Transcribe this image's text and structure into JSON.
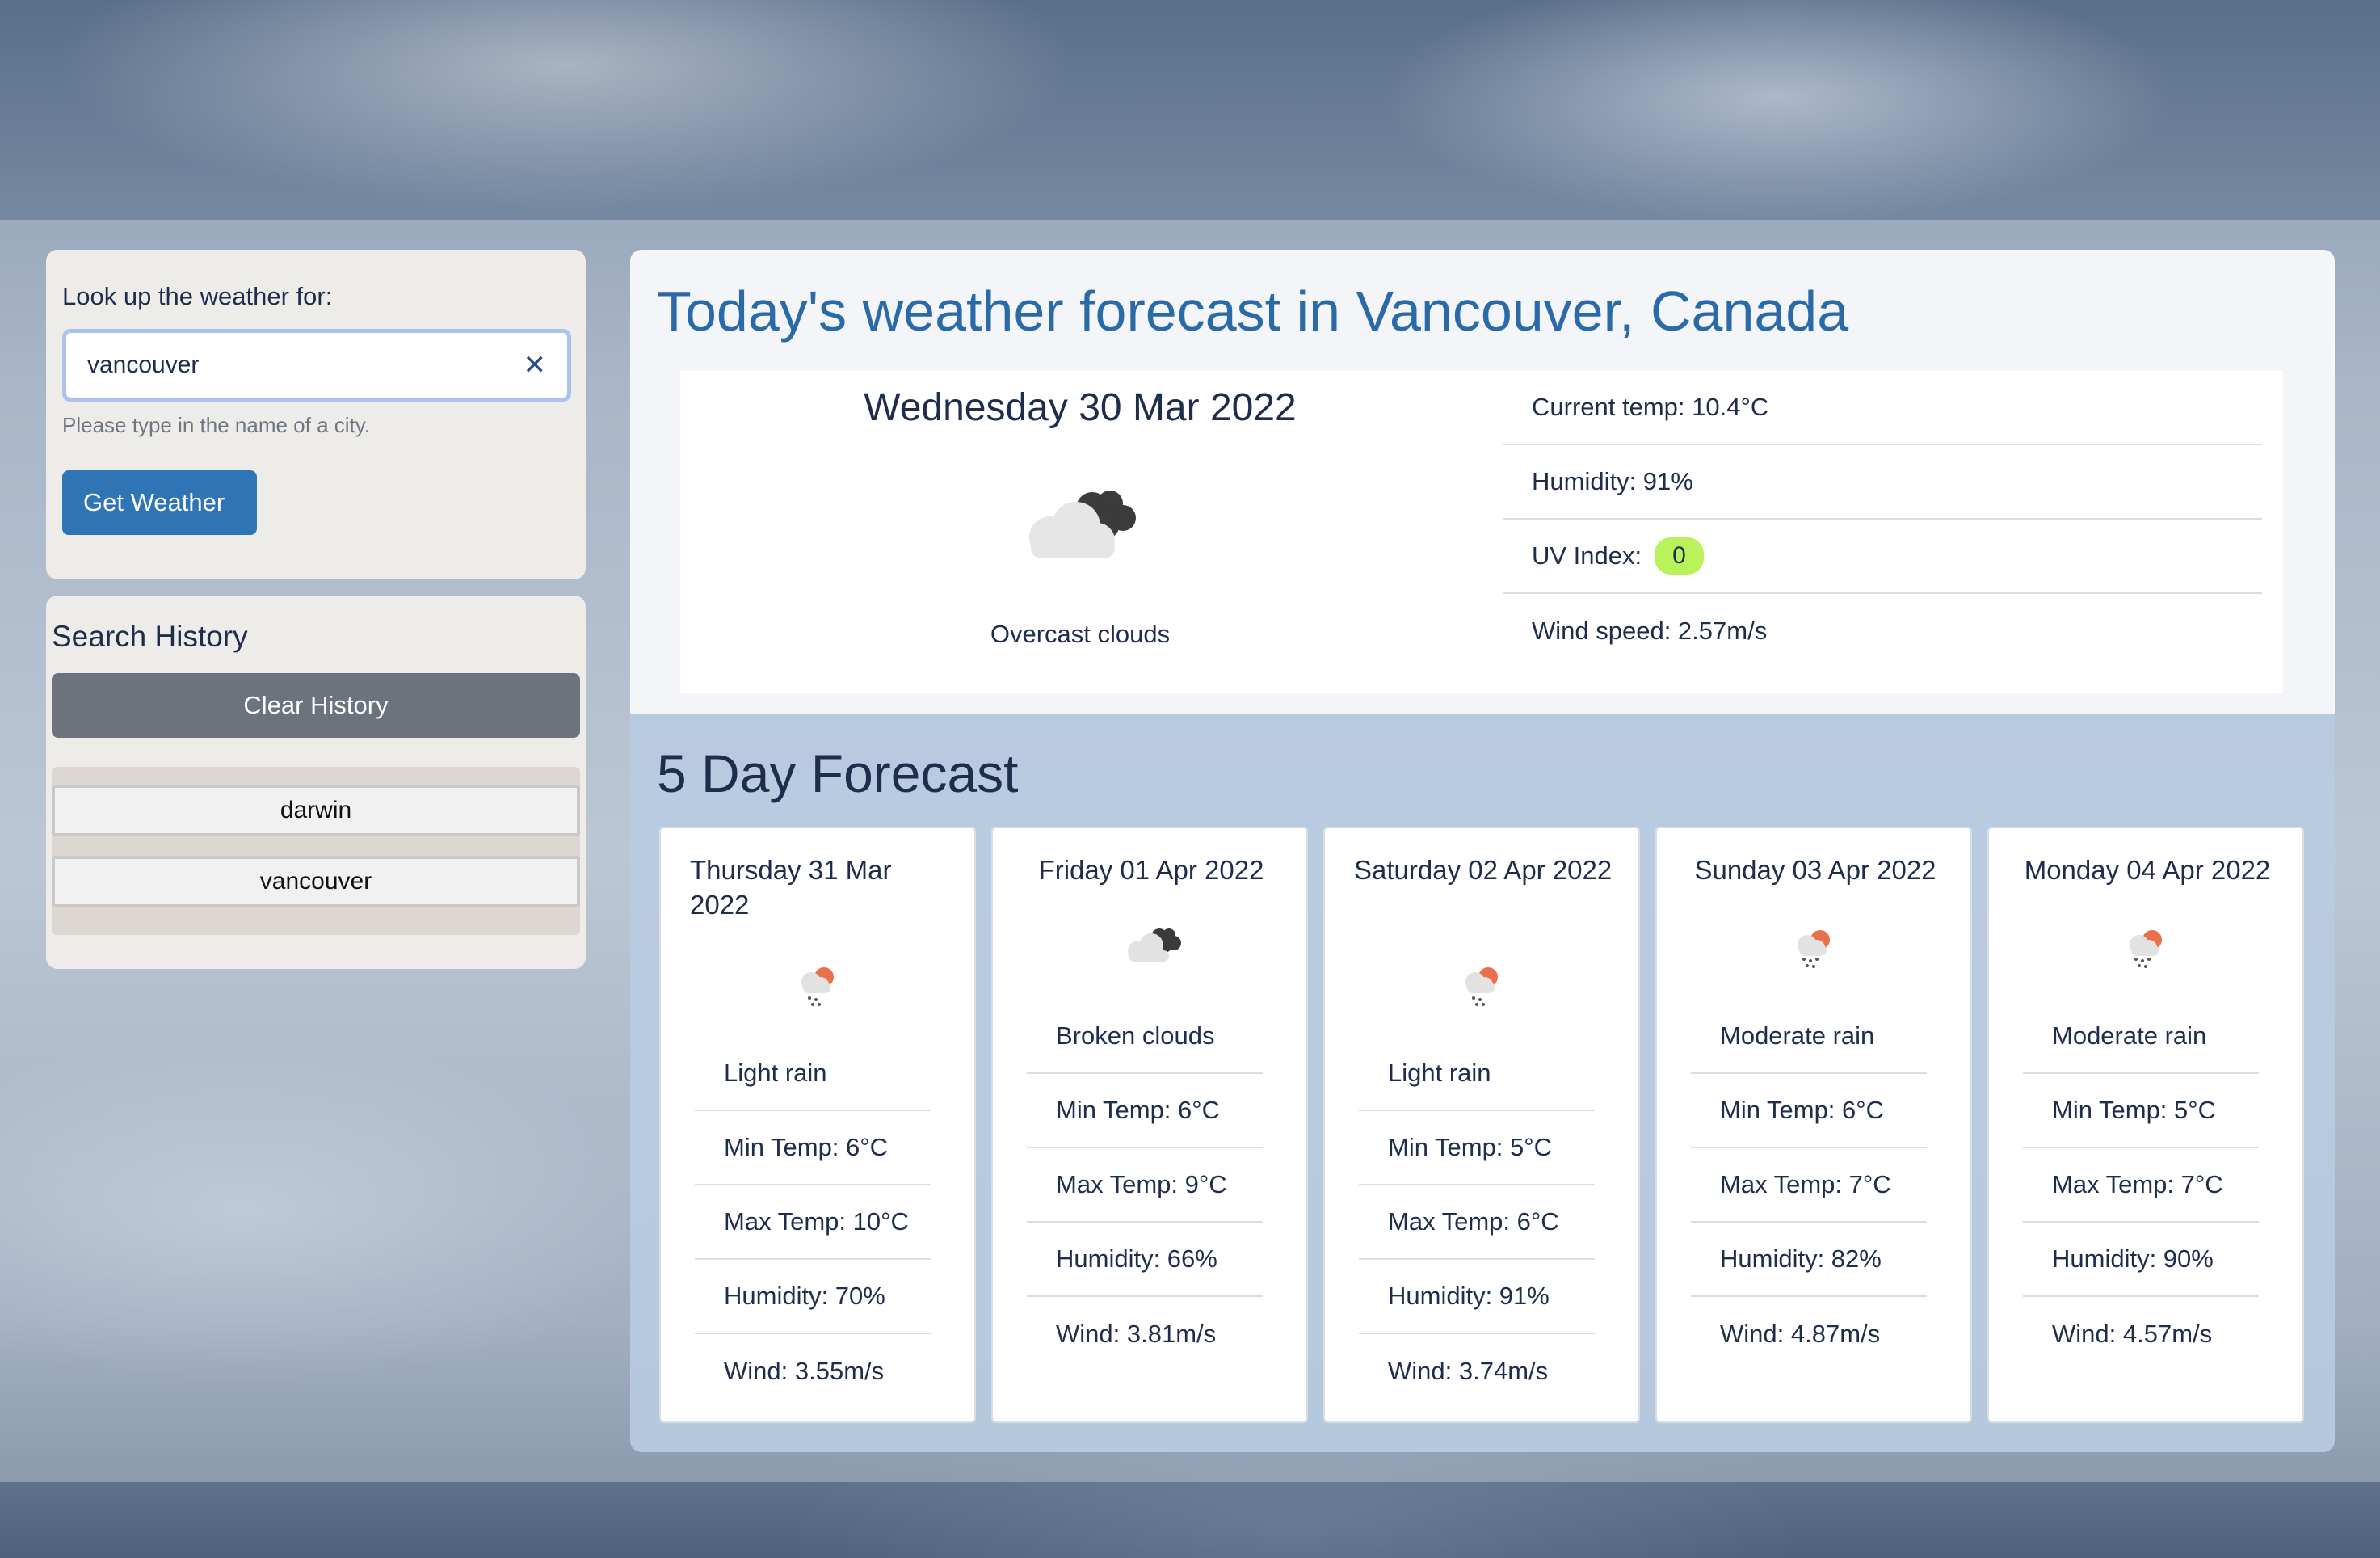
{
  "search": {
    "label": "Look up the weather for:",
    "value": "vancouver",
    "hint": "Please type in the name of a city.",
    "button_label": "Get Weather",
    "clear_icon": "close-icon"
  },
  "history": {
    "title": "Search History",
    "clear_label": "Clear History",
    "items": [
      "darwin",
      "vancouver"
    ]
  },
  "today": {
    "title": "Today's weather forecast in Vancouver, Canada",
    "date": "Wednesday 30 Mar 2022",
    "icon": "overcast-clouds-icon",
    "description": "Overcast clouds",
    "current_temp": "Current temp: 10.4°C",
    "humidity": "Humidity: 91%",
    "uv_label": "UV Index:",
    "uv_value": "0",
    "uv_color": "#b9f25a",
    "wind": "Wind speed: 2.57m/s"
  },
  "forecast": {
    "title": "5 Day Forecast",
    "days": [
      {
        "date": "Thursday 31 Mar 2022",
        "icon": "light-rain-icon",
        "description": "Light rain",
        "min": "Min Temp: 6°C",
        "max": "Max Temp: 10°C",
        "humidity": "Humidity: 70%",
        "wind": "Wind: 3.55m/s"
      },
      {
        "date": "Friday 01 Apr 2022",
        "icon": "broken-clouds-icon",
        "description": "Broken clouds",
        "min": "Min Temp: 6°C",
        "max": "Max Temp: 9°C",
        "humidity": "Humidity: 66%",
        "wind": "Wind: 3.81m/s"
      },
      {
        "date": "Saturday 02 Apr 2022",
        "icon": "light-rain-icon",
        "description": "Light rain",
        "min": "Min Temp: 5°C",
        "max": "Max Temp: 6°C",
        "humidity": "Humidity: 91%",
        "wind": "Wind: 3.74m/s"
      },
      {
        "date": "Sunday 03 Apr 2022",
        "icon": "moderate-rain-icon",
        "description": "Moderate rain",
        "min": "Min Temp: 6°C",
        "max": "Max Temp: 7°C",
        "humidity": "Humidity: 82%",
        "wind": "Wind: 4.87m/s"
      },
      {
        "date": "Monday 04 Apr 2022",
        "icon": "moderate-rain-icon",
        "description": "Moderate rain",
        "min": "Min Temp: 5°C",
        "max": "Max Temp: 7°C",
        "humidity": "Humidity: 90%",
        "wind": "Wind: 4.57m/s"
      }
    ]
  }
}
